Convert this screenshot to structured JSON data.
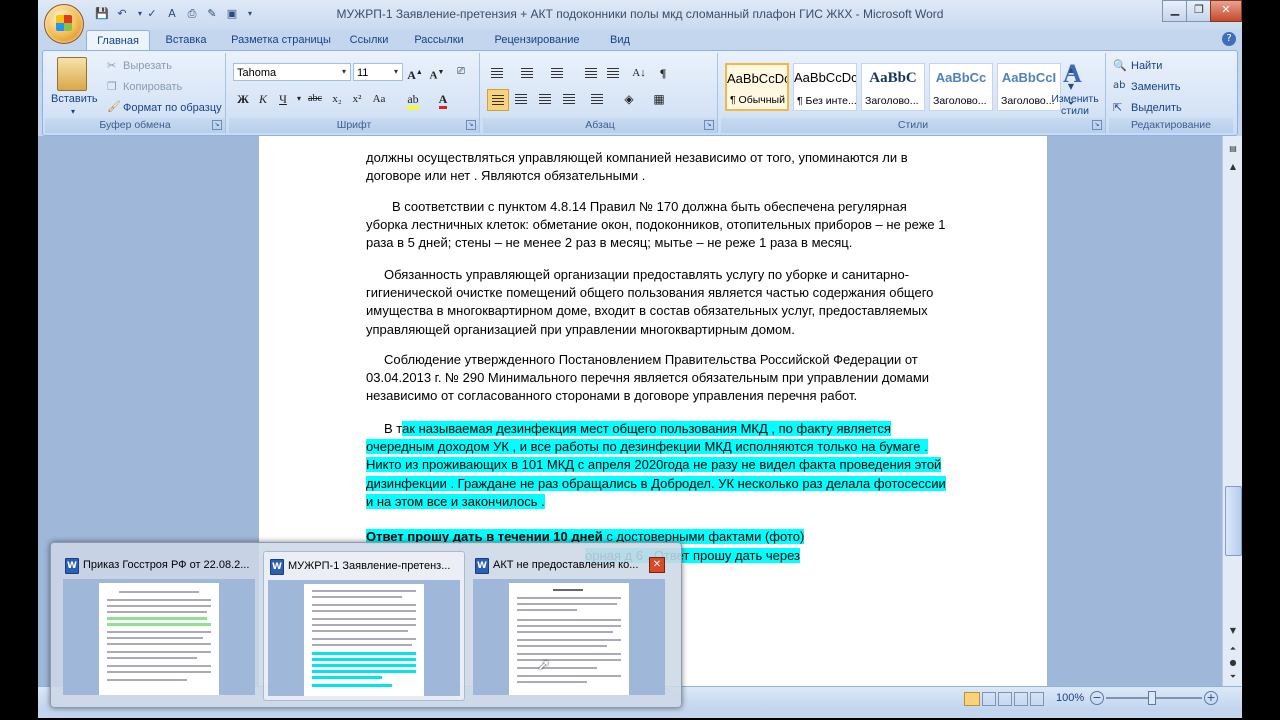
{
  "window": {
    "title": "МУЖРП-1  Заявление-претензия + АКТ подоконники  полы мкд  сломанный плафон ГИС ЖКХ - Microsoft Word"
  },
  "ribbon": {
    "tabs": [
      "Главная",
      "Вставка",
      "Разметка страницы",
      "Ссылки",
      "Рассылки",
      "Рецензирование",
      "Вид"
    ],
    "active_tab": "Главная",
    "clipboard": {
      "paste": "Вставить",
      "cut": "Вырезать",
      "copy": "Копировать",
      "format_painter": "Формат по образцу",
      "label": "Буфер обмена"
    },
    "font": {
      "font_name": "Tahoma",
      "font_size": "11",
      "label": "Шрифт"
    },
    "paragraph": {
      "label": "Абзац"
    },
    "styles": {
      "items": [
        {
          "preview": "AaBbCcDc",
          "name": "¶ Обычный"
        },
        {
          "preview": "AaBbCcDc",
          "name": "¶ Без инте..."
        },
        {
          "preview": "AaBbC",
          "name": "Заголово..."
        },
        {
          "preview": "AaBbCc",
          "name": "Заголово..."
        },
        {
          "preview": "AaBbCcI",
          "name": "Заголово..."
        }
      ],
      "change_styles": "Изменить стили",
      "label": "Стили"
    },
    "editing": {
      "find": "Найти",
      "replace": "Заменить",
      "select": "Выделить",
      "label": "Редактирование"
    }
  },
  "document": {
    "p1": "должны осуществляться управляющей компанией независимо от того, упоминаются ли в договоре или нет .  Являются обязательными .",
    "p2": "В соответствии с пунктом 4.8.14 Правил № 170 должна быть обеспечена регулярная уборка лестничных клеток: обметание окон, подоконников, отопительных приборов – не реже 1 раза в 5 дней; стены – не менее 2 раз в месяц; мытье – не реже 1 раза в месяц.",
    "p3": "Обязанность управляющей организации предоставлять услугу по уборке и санитарно-гигиенической очистке помещений общего пользования является частью содержания общего имущества в многоквартирном доме, входит в состав обязательных услуг, предоставляемых управляющей организацией при управлении многоквартирным домом.",
    "p4": "Соблюдение утвержденного Постановлением Правительства Российской Федерации от 03.04.2013 г. № 290 Минимального перечня является обязательным при управлении домами независимо от согласованного сторонами в договоре управления перечня работ.",
    "p5_start": "В т",
    "p5_highlight": "ак называемая   дезинфекция  мест общего пользования МКД ,  по факту   является очередным доходом  УК  ,  и  все работы по дезинфекции   МКД  исполняются  только на бумаге  .  Никто  из  проживающих в 101 МКД  с  апреля 2020года  не  разу не видел факта  проведения  этой дизинфекции . Граждане не раз  обращались в Добродел. УК несколько раз  делала  фотосессии  и на этом все   и закончилось .",
    "p6_bold": "Ответ  прошу  дать в течении  10 дней",
    "p6_rest": "  с  достоверными фактами (фото)",
    "p7": "орная д 6 . Ответ прошу дать  через"
  },
  "statusbar": {
    "zoom": "100%"
  },
  "taskbar_previews": [
    {
      "title": "Приказ Госстроя РФ от 22.08.2..."
    },
    {
      "title": "МУЖРП-1  Заявление-претенз..."
    },
    {
      "title": "АКТ не предоставления ко..."
    }
  ],
  "colors": {
    "highlight": "#00ffff",
    "ribbon_bg": "#d6e4f6",
    "doc_bg": "#9fb7d9"
  }
}
